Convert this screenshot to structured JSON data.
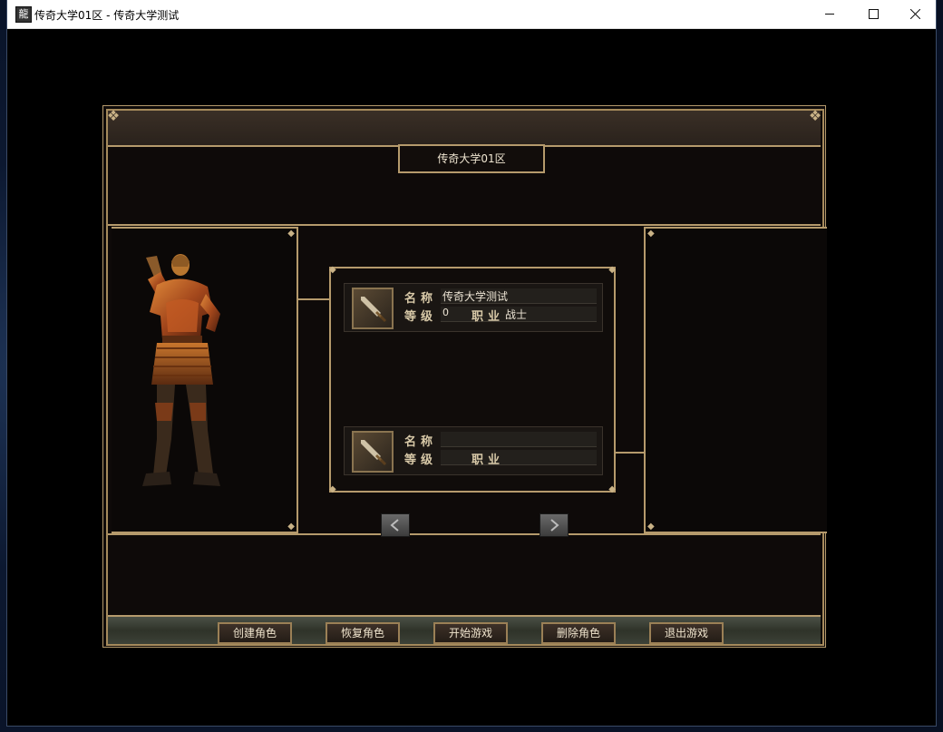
{
  "window": {
    "title": "传奇大学01区 - 传奇大学测试",
    "icon": "app-icon"
  },
  "server": {
    "name": "传奇大学01区"
  },
  "slot1": {
    "name_label": "名称",
    "name_value": "传奇大学测试",
    "level_label": "等级",
    "level_value": "0",
    "job_label": "职业",
    "job_value": "战士",
    "icon": "sword-icon"
  },
  "slot2": {
    "name_label": "名称",
    "name_value": "",
    "level_label": "等级",
    "level_value": "",
    "job_label": "职业",
    "job_value": "",
    "icon": "sword-icon"
  },
  "buttons": {
    "create": "创建角色",
    "restore": "恢复角色",
    "start": "开始游戏",
    "delete": "删除角色",
    "exit": "退出游戏"
  },
  "colors": {
    "frame_gold": "#b59a6c",
    "panel_bg": "#0e0a09"
  }
}
